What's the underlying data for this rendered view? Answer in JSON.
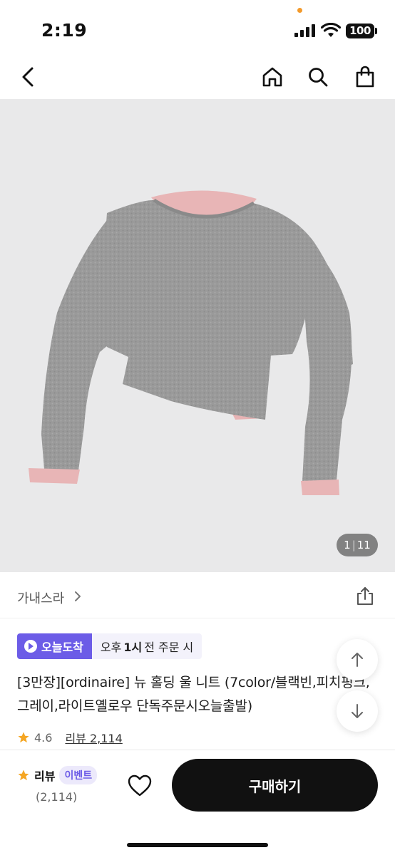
{
  "status": {
    "time": "2:19",
    "battery": "100"
  },
  "nav": {
    "icons": [
      "back-icon",
      "home-icon",
      "search-icon",
      "shopping-bag-icon"
    ]
  },
  "hero": {
    "pager_current": "1",
    "pager_total": "11"
  },
  "brand": {
    "name": "가내스라"
  },
  "delivery": {
    "badge": "오늘도착",
    "text_pre": "오후",
    "text_bold": "1시",
    "text_post": "전 주문 시"
  },
  "product": {
    "title": "[3만장][ordinaire] 뉴 홀딩 울 니트 (7color/블랙빈,피치핑크,그레이,라이트옐로우 단독주문시오늘출발)",
    "rating": "4.6",
    "review_link": "리뷰 2,114"
  },
  "bottom": {
    "review_label": "리뷰",
    "event_badge": "이벤트",
    "review_count": "(2,114)",
    "buy_label": "구매하기"
  },
  "colors": {
    "accent": "#6c5ce7",
    "star": "#f5a623",
    "buy_bg": "#111111"
  }
}
